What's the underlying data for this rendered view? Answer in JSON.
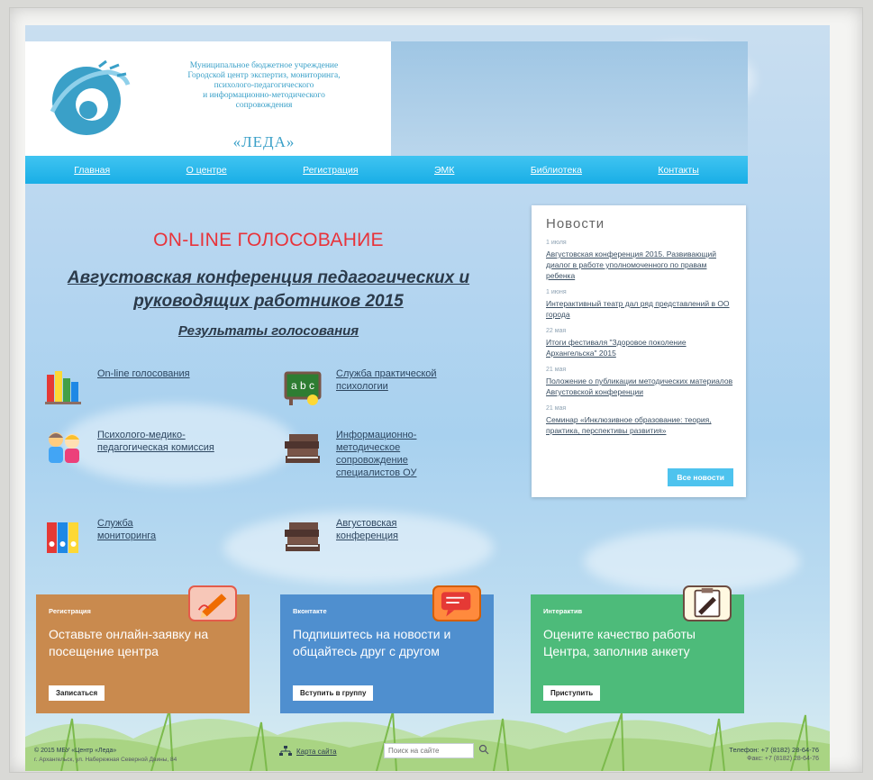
{
  "header": {
    "org_lines": [
      "Муниципальное бюджетное учреждение",
      "Городской центр экспертиз, мониторинга,",
      "психолого-педагогического",
      "и информационно-методического",
      "сопровождения"
    ],
    "brand": "«ЛЕДА»"
  },
  "nav": {
    "items": [
      "Главная",
      "О центре",
      "Регистрация",
      "ЭМК",
      "Библиотека",
      "Контакты"
    ]
  },
  "main": {
    "headline": "ON-LINE ГОЛОСОВАНИЕ",
    "conference_line1": "Августовская конференция педагогических и",
    "conference_line2": "руководящих работников 2015",
    "results_link": "Результаты голосования",
    "services": [
      {
        "label": "On-line голосования",
        "icon": "books-icon"
      },
      {
        "label": "Служба практической психологии",
        "icon": "chalkboard-icon"
      },
      {
        "label": "Психолого-медико-педагогическая комиссия",
        "icon": "children-icon"
      },
      {
        "label": "Информационно-методическое сопровождение специалистов ОУ",
        "icon": "book-stack-icon"
      },
      {
        "label": "Служба мониторинга",
        "icon": "binders-icon"
      },
      {
        "label": "Августовская конференция",
        "icon": "book-stack-icon"
      }
    ]
  },
  "news": {
    "title": "Новости",
    "items": [
      {
        "date": "1 июля",
        "text": "Августовская конференция 2015. Развивающий диалог в работе уполномоченного по правам ребенка"
      },
      {
        "date": "1 июня",
        "text": "Интерактивный театр дал ряд представлений в ОО города"
      },
      {
        "date": "22 мая",
        "text": "Итоги фестиваля \"Здоровое поколение Архангельска\" 2015"
      },
      {
        "date": "21 мая",
        "text": "Положение о публикации методических материалов Августовской конференции"
      },
      {
        "date": "21 мая",
        "text": "Семинар «Инклюзивное образование: теория, практика, перспективы развития»"
      }
    ],
    "all_button": "Все новости"
  },
  "cards": [
    {
      "tag": "Регистрация",
      "text": "Оставьте онлайн-заявку на посещение центра",
      "button": "Записаться",
      "color": "#c98a4e"
    },
    {
      "tag": "Вконтакте",
      "text": "Подпишитесь на новости и общайтесь друг с другом",
      "button": "Вступить в группу",
      "color": "#4f8fcf"
    },
    {
      "tag": "Интерактив",
      "text": "Оцените качество работы Центра, заполнив анкету",
      "button": "Приступить",
      "color": "#4dbb7a"
    }
  ],
  "footer": {
    "copyright": "© 2015 МБУ «Центр «Леда»",
    "address": "г. Архангельск, ул. Набережная Северной Двины, 84",
    "sitemap": "Карта сайта",
    "search_placeholder": "Поиск на сайте",
    "phone": "Телефон: +7 (8182) 28-64-76",
    "fax": "Факс: +7 (8182) 28-64-76"
  },
  "colors": {
    "nav": "#19aee6",
    "headline": "#e8333a",
    "brand": "#3aa0c8"
  }
}
